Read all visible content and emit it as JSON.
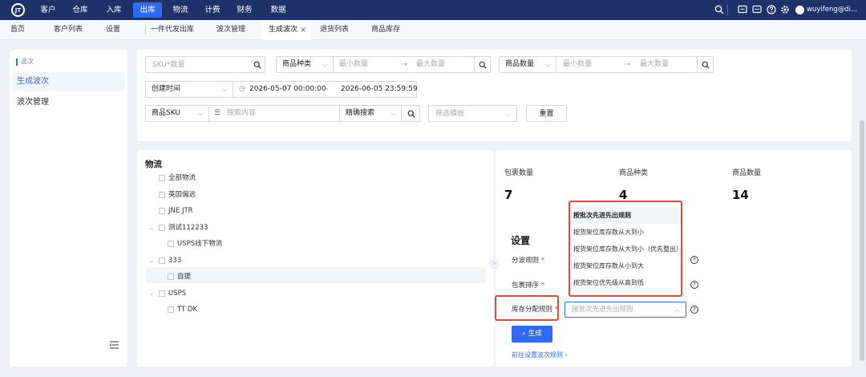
{
  "logo": "JT",
  "nav": {
    "items": [
      "客户",
      "仓库",
      "入库",
      "出库",
      "物流",
      "计费",
      "财务",
      "数据"
    ],
    "user": "wuyifeng@di..."
  },
  "tabs": [
    "首页",
    "客户列表",
    "设置",
    "一件代发出库",
    "波次管理",
    "生成波次",
    "退货列表",
    "商品库存"
  ],
  "sidebar": {
    "section": "波次",
    "items": [
      "生成波次",
      "波次管理"
    ]
  },
  "filters": {
    "sku_placeholder": "SKU*数量",
    "kind_select": "商品种类",
    "kind_min": "最小数量",
    "kind_max": "最大数量",
    "qty_select": "商品数量",
    "qty_min": "最小数量",
    "qty_max": "最大数量",
    "time_select": "创建时间",
    "time_start": "2026-05-07 00:00:00",
    "time_sep": "-",
    "time_end": "2026-06-05 23:59:59",
    "sku_select": "商品SKU",
    "search_placeholder": "搜索内容",
    "exact_select": "精确搜索",
    "template_placeholder": "筛选模板",
    "reset": "重置"
  },
  "logistics": {
    "title": "物流",
    "rows": [
      {
        "label": "全部物流",
        "level": 0,
        "expand": false
      },
      {
        "label": "英国偏远",
        "level": 0,
        "expand": false
      },
      {
        "label": "JNE JTR",
        "level": 0,
        "expand": false
      },
      {
        "label": "测试112233",
        "level": 0,
        "expand": true
      },
      {
        "label": "USPS线下物流",
        "level": 1,
        "expand": false
      },
      {
        "label": "333",
        "level": 0,
        "expand": true
      },
      {
        "label": "自提",
        "level": 1,
        "expand": false,
        "selected": true
      },
      {
        "label": "USPS",
        "level": 0,
        "expand": true
      },
      {
        "label": "TT DK",
        "level": 1,
        "expand": false
      }
    ]
  },
  "stats": [
    {
      "label": "包裹数量",
      "value": "7"
    },
    {
      "label": "商品种类",
      "value": "4"
    },
    {
      "label": "商品数量",
      "value": "14"
    }
  ],
  "settings": {
    "title": "设置",
    "fields": [
      {
        "label": "分波规则",
        "required": "*"
      },
      {
        "label": "包裹排序",
        "required": "*"
      },
      {
        "label": "库存分配规则",
        "required": "*"
      }
    ],
    "alloc_placeholder": "按批次先进先出规则",
    "generate": "生成",
    "link": "前往设置波次规则 ›"
  },
  "dropdown": [
    "按批次先进先出规则",
    "按货架位库存数从大到小",
    "按货架位库存数从大到小（优先整出）",
    "按货架位库存数从小到大",
    "按货架位优先级从高到低"
  ],
  "colors": {
    "nav_bg": "#1e3269",
    "accent": "#2f6bf2",
    "highlight": "#e04a3f"
  }
}
